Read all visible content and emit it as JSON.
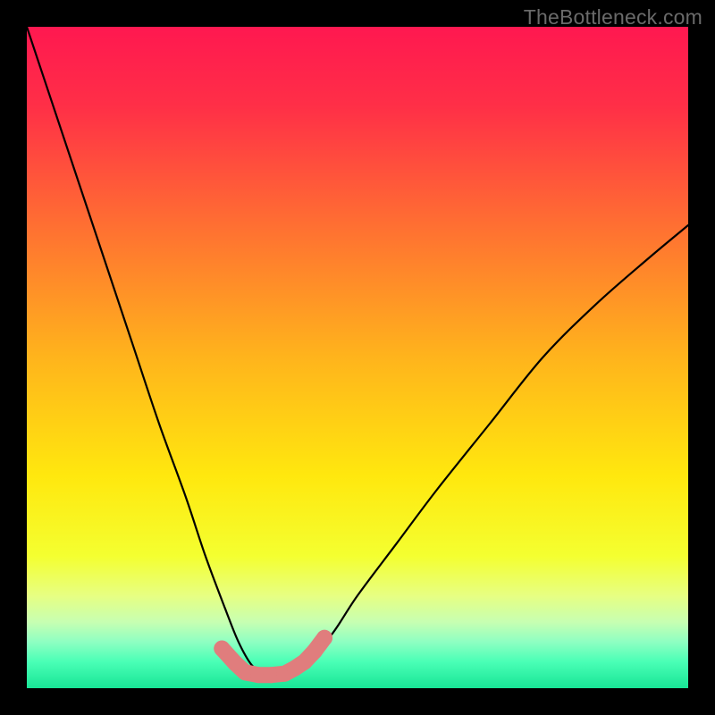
{
  "watermark": {
    "text": "TheBottleneck.com"
  },
  "chart_data": {
    "type": "line",
    "title": "",
    "xlabel": "",
    "ylabel": "",
    "xlim": [
      0,
      100
    ],
    "ylim": [
      0,
      100
    ],
    "grid": false,
    "legend": false,
    "background_gradient_stops": [
      {
        "pct": 0,
        "color": "#ff1850"
      },
      {
        "pct": 12,
        "color": "#ff2f47"
      },
      {
        "pct": 30,
        "color": "#ff6f32"
      },
      {
        "pct": 50,
        "color": "#ffb41c"
      },
      {
        "pct": 68,
        "color": "#ffe80e"
      },
      {
        "pct": 80,
        "color": "#f4ff30"
      },
      {
        "pct": 86,
        "color": "#e7ff82"
      },
      {
        "pct": 90,
        "color": "#c7ffb2"
      },
      {
        "pct": 93,
        "color": "#8effc2"
      },
      {
        "pct": 96,
        "color": "#4affb6"
      },
      {
        "pct": 100,
        "color": "#18e596"
      }
    ],
    "series": [
      {
        "name": "bottleneck-curve",
        "stroke": "#000000",
        "stroke_width": 2.2,
        "x": [
          0,
          4,
          8,
          12,
          16,
          20,
          24,
          27,
          30,
          32,
          34,
          36,
          38,
          39.5,
          42,
          46,
          50,
          56,
          62,
          70,
          78,
          86,
          94,
          100
        ],
        "y": [
          100,
          88,
          76,
          64,
          52,
          40,
          29,
          20,
          12,
          7,
          3.5,
          2,
          2,
          2.2,
          4,
          8,
          14,
          22,
          30,
          40,
          50,
          58,
          65,
          70
        ]
      },
      {
        "name": "flat-markers",
        "type": "scatter",
        "marker_color": "#e07d7d",
        "marker_radius": 9,
        "x": [
          29.5,
          31.5,
          33,
          35,
          37,
          39,
          40.5,
          42,
          43.5,
          45
        ],
        "y": [
          6.0,
          3.8,
          2.4,
          2.0,
          2.0,
          2.2,
          3.0,
          4.0,
          5.6,
          7.6
        ]
      }
    ]
  }
}
